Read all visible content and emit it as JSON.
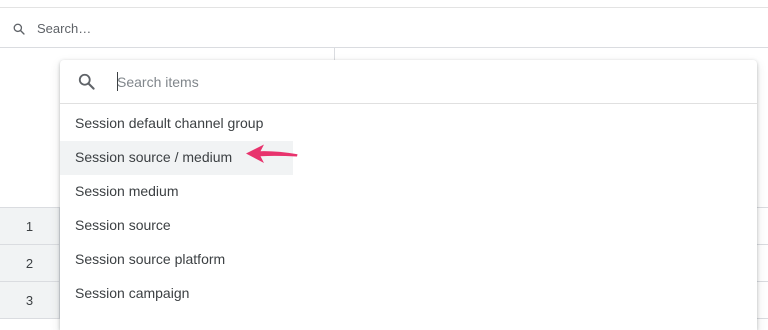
{
  "page": {
    "search_placeholder": "Search…",
    "rows": [
      "1",
      "2",
      "3"
    ]
  },
  "dropdown": {
    "search_placeholder": "Search items",
    "items": [
      {
        "label": "Session default channel group"
      },
      {
        "label": "Session source / medium"
      },
      {
        "label": "Session medium"
      },
      {
        "label": "Session source"
      },
      {
        "label": "Session source platform"
      },
      {
        "label": "Session campaign"
      }
    ],
    "highlighted_item": "Session source / medium"
  },
  "annotation": {
    "arrow_color": "#e8336d",
    "arrow_icon": "pointer-arrow-icon"
  }
}
